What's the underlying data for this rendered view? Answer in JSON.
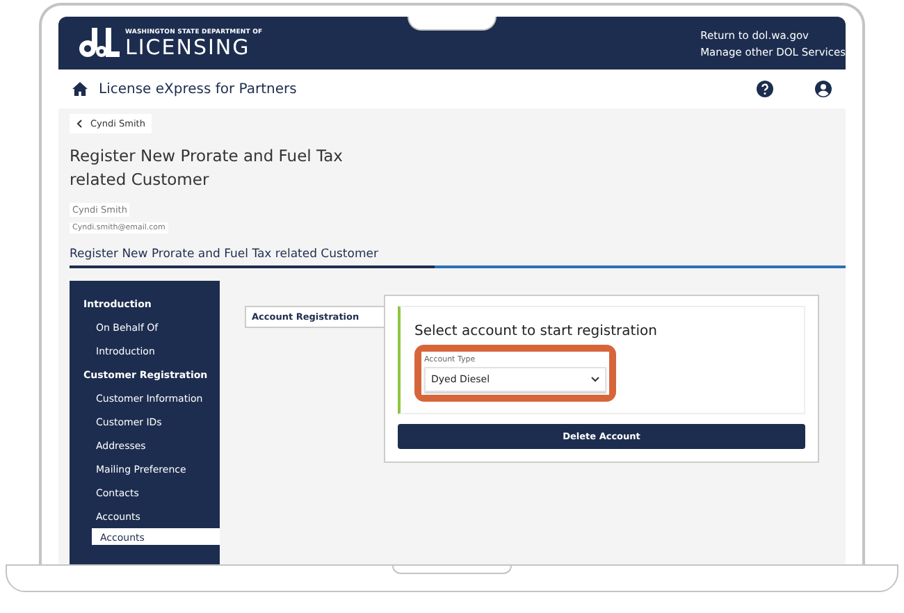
{
  "header": {
    "agency_line": "WASHINGTON STATE DEPARTMENT OF",
    "agency_name": "LICENSING",
    "links": [
      "Return to dol.wa.gov",
      "Manage other DOL Services"
    ]
  },
  "nav": {
    "title": "License eXpress for Partners"
  },
  "breadcrumb": {
    "label": "Cyndi Smith"
  },
  "page": {
    "title": "Register New Prorate and Fuel Tax related Customer",
    "customer_name": "Cyndi Smith",
    "customer_email": "Cyndi.smith@email.com",
    "section_title": "Register New Prorate and Fuel Tax related Customer"
  },
  "sidebar": {
    "items": [
      {
        "kind": "heading",
        "label": "Introduction",
        "selected": false
      },
      {
        "kind": "item",
        "label": "On Behalf Of",
        "selected": false
      },
      {
        "kind": "item",
        "label": "Introduction",
        "selected": false
      },
      {
        "kind": "heading",
        "label": "Customer Registration",
        "selected": false
      },
      {
        "kind": "item",
        "label": "Customer Information",
        "selected": false
      },
      {
        "kind": "item",
        "label": "Customer IDs",
        "selected": false
      },
      {
        "kind": "item",
        "label": "Addresses",
        "selected": false
      },
      {
        "kind": "item",
        "label": "Mailing Preference",
        "selected": false
      },
      {
        "kind": "item",
        "label": "Contacts",
        "selected": false
      },
      {
        "kind": "item",
        "label": "Accounts",
        "selected": false
      },
      {
        "kind": "tab",
        "label": "Accounts",
        "selected": true
      }
    ]
  },
  "tabs": [
    {
      "label": "Account Registration",
      "selected": true
    }
  ],
  "card": {
    "title": "Select account to start registration",
    "field": {
      "label": "Account Type",
      "value": "Dyed Diesel",
      "highlighted": true
    },
    "button": "Delete Account"
  }
}
